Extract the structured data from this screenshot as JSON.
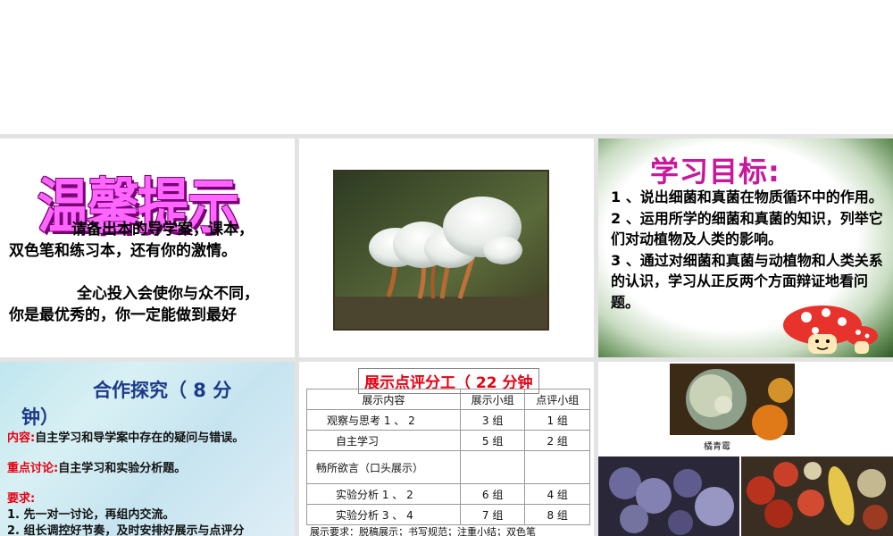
{
  "slide1": {
    "wordart": "温馨提示",
    "line1": "请备出本的导学案，课本，",
    "line2": "双色笔和练习本，还有你的激情。",
    "line3": "全心投入会使你与众不同，",
    "line4": "你是最优秀的，你一定能做到最好"
  },
  "slide3": {
    "title": "学习目标:",
    "goals": [
      "1 、说出细菌和真菌在物质循环中的作用。",
      "2 、运用所学的细菌和真菌的知识，列举它们对动植物及人类的影响。",
      "3 、通过对细菌和真菌与动植物和人类关系的认识，学习从正反两个方面辩证地看问题。"
    ]
  },
  "slide4": {
    "title_a": "合作探究（ 8 分",
    "title_b": "钟）",
    "content_label": "内容:",
    "content_text": "自主学习和导学案中存在的疑问与错误。",
    "focus_label": "重点讨论:",
    "focus_text": "自主学习和实验分析题。",
    "req_label": "要求:",
    "req1": "1. 先一对一讨论，再组内交流。",
    "req2": "2. 组长调控好节奏，及时安排好展示与点评分"
  },
  "slide5": {
    "title": "展示点评分工（ 22 分钟",
    "headers": [
      "展示内容",
      "展示小组",
      "点评小组"
    ],
    "rows": [
      [
        "观察与思考 1 、 2",
        "3 组",
        "1 组"
      ],
      [
        "自主学习",
        "5 组",
        "2 组"
      ],
      [
        "畅所欲言（口头展示）",
        "",
        ""
      ],
      [
        "实验分析 1 、 2",
        "6 组",
        "4 组"
      ],
      [
        "实验分析 3 、 4",
        "7 组",
        "8 组"
      ]
    ],
    "footer": "展示要求：脱稿展示；书写规范；注重小结；双色笔"
  },
  "slide6": {
    "caption": "橘青霉"
  }
}
